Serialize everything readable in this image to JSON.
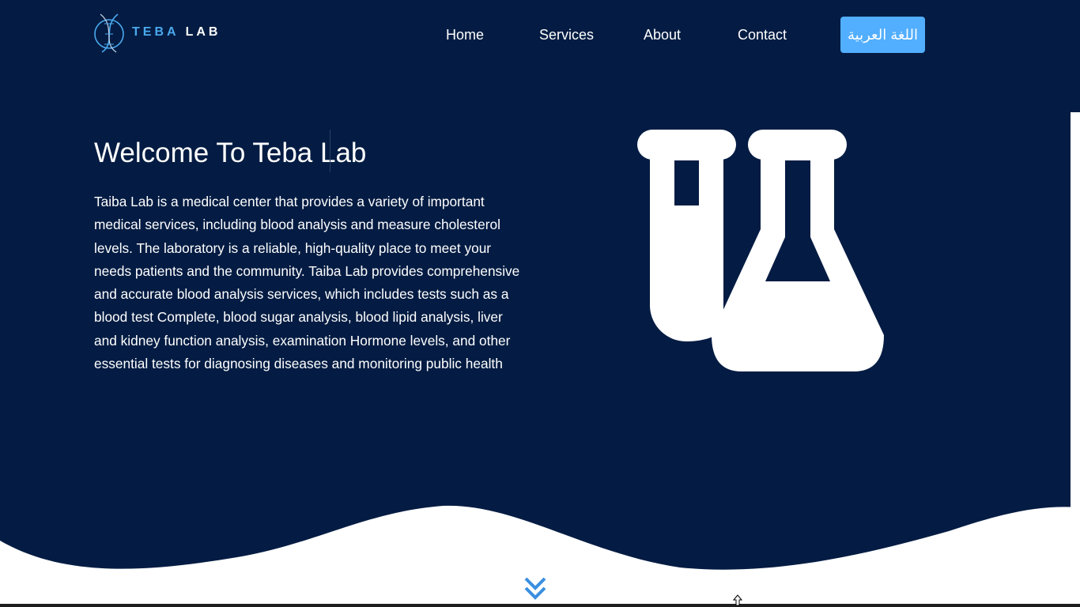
{
  "brand": {
    "part1": "TEBA",
    "part2": "LAB",
    "logo_icon": "dna-circle-icon",
    "accent_color": "#4aa9ef"
  },
  "nav": {
    "links": [
      "Home",
      "Services",
      "About",
      "Contact"
    ],
    "language_button": "اللغة العربية",
    "button_color": "#52aefe"
  },
  "hero": {
    "title": "Welcome To Teba Lab",
    "description": "Taiba Lab is a medical center that provides a variety of important medical services, including blood analysis and measure cholesterol levels. The laboratory is a reliable, high-quality place to meet your needs patients and the community. Taiba Lab provides comprehensive and accurate blood analysis services, which includes tests such as a blood test Complete, blood sugar analysis, blood lipid analysis, liver and kidney function analysis, examination Hormone levels, and other essential tests for diagnosing diseases and monitoring public health",
    "illustration_icon": "flask-test-tube-icon",
    "background_color": "#041c43"
  },
  "scroll_indicator_icon": "double-chevron-down-icon"
}
